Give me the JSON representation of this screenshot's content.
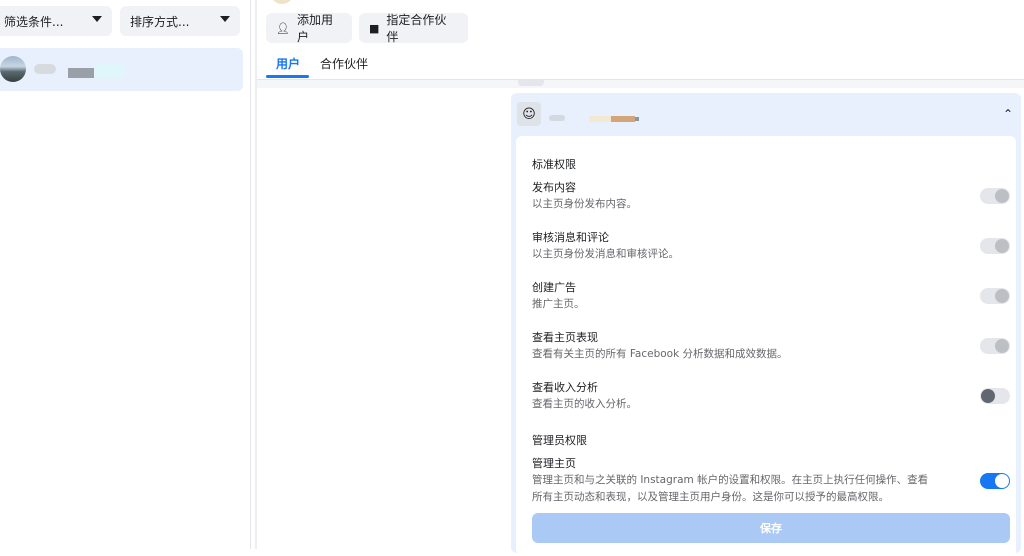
{
  "filters": {
    "filter_label": "筛选条件...",
    "sort_label": "排序方式..."
  },
  "actions": {
    "add_user_label": "添加用户",
    "assign_partner_label": "指定合作伙伴"
  },
  "tabs": [
    {
      "label": "用户",
      "active": true
    },
    {
      "label": "合作伙伴",
      "active": false
    }
  ],
  "permissions": {
    "standard_heading": "标准权限",
    "items": [
      {
        "title": "发布内容",
        "desc": "以主页身份发布内容。",
        "state": "disabled-on"
      },
      {
        "title": "审核消息和评论",
        "desc": "以主页身份发消息和审核评论。",
        "state": "disabled-on"
      },
      {
        "title": "创建广告",
        "desc": "推广主页。",
        "state": "disabled-on"
      },
      {
        "title": "查看主页表现",
        "desc": "查看有关主页的所有 Facebook 分析数据和成效数据。",
        "state": "disabled-on"
      },
      {
        "title": "查看收入分析",
        "desc": "查看主页的收入分析。",
        "state": "off"
      }
    ],
    "admin_heading": "管理员权限",
    "admin_item": {
      "title": "管理主页",
      "desc_line1": "管理主页和与之关联的 Instagram 帐户的设置和权限。在主页上执行任何操作、查看",
      "desc_line2": "所有主页动态和表现，以及管理主页用户身份。这是你可以授予的最高权限。",
      "state": "on"
    },
    "save_label": "保存"
  },
  "colors": {
    "accent": "#1877f2",
    "card_bg": "#e7f0fc",
    "save_disabled": "#aac9f5"
  }
}
